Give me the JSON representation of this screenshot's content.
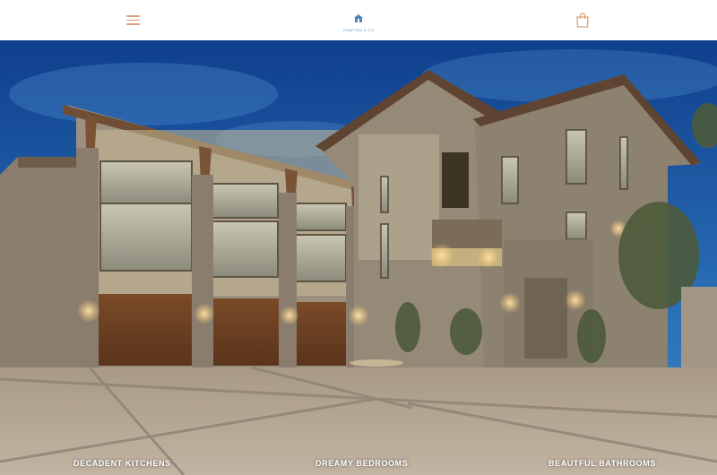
{
  "header": {
    "logo_text": "CRAFTED & CO",
    "menu_icon": "hamburger-menu-icon",
    "cart_icon": "shopping-bag-icon"
  },
  "hero": {
    "image_subject": "luxury-stone-house-exterior-at-dusk"
  },
  "categories": [
    {
      "label": "DECADENT KITCHENS"
    },
    {
      "label": "DREAMY BEDROOMS"
    },
    {
      "label": "BEAUTFUL BATHROOMS"
    }
  ],
  "colors": {
    "accent": "#d9a27a",
    "logo": "#5a8fb8",
    "sky_top": "#0f3f8c",
    "sky_bottom": "#3f86c4",
    "stone": "#8e8171",
    "garage_door": "#6b4023",
    "driveway": "#b8aa98"
  }
}
